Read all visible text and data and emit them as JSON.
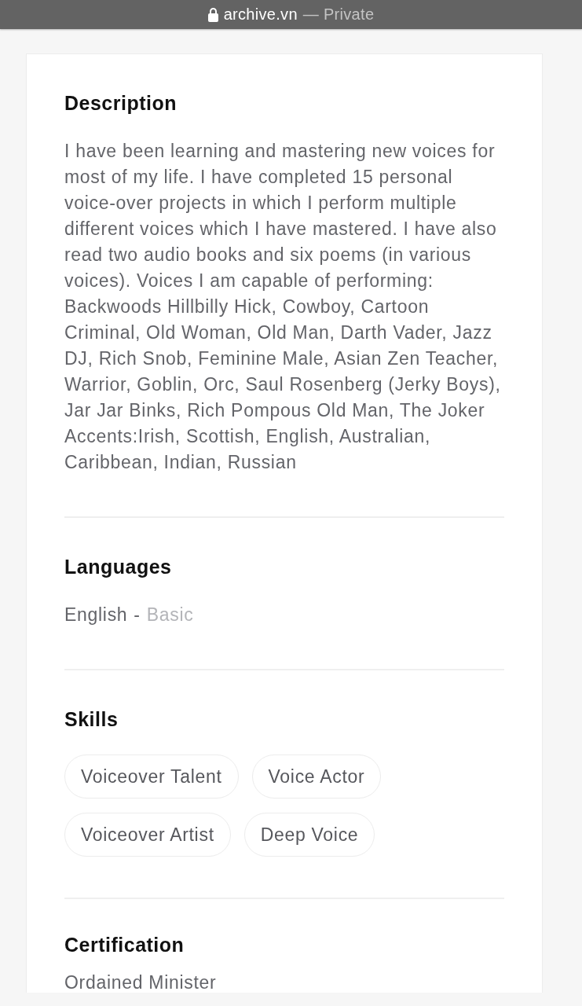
{
  "browser_bar": {
    "domain": "archive.vn",
    "status": "— Private"
  },
  "sections": [
    {
      "kind": "text",
      "heading": "Description",
      "text": "I have been learning and mastering new voices for most of my life. I have completed 15 personal voice-over projects in which I perform multiple different voices which I have mastered. I have also read two audio books and six poems (in various voices). Voices I am capable of performing: Backwoods Hillbilly Hick, Cowboy, Cartoon Criminal, Old Woman, Old Man, Darth Vader, Jazz DJ, Rich Snob, Feminine Male, Asian Zen Teacher, Warrior, Goblin, Orc, Saul Rosenberg (Jerky Boys), Jar Jar Binks, Rich Pompous Old Man, The Joker Accents:Irish, Scottish, English, Australian, Caribbean, Indian, Russian"
    },
    {
      "kind": "languages",
      "heading": "Languages",
      "languages": [
        {
          "name": "English",
          "separator": "-",
          "proficiency": "Basic"
        }
      ]
    },
    {
      "kind": "tags",
      "heading": "Skills",
      "tags": [
        "Voiceover Talent",
        "Voice Actor",
        "Voiceover Artist",
        "Deep Voice"
      ]
    },
    {
      "kind": "text",
      "heading": "Certification",
      "text": "Ordained Minister"
    }
  ]
}
